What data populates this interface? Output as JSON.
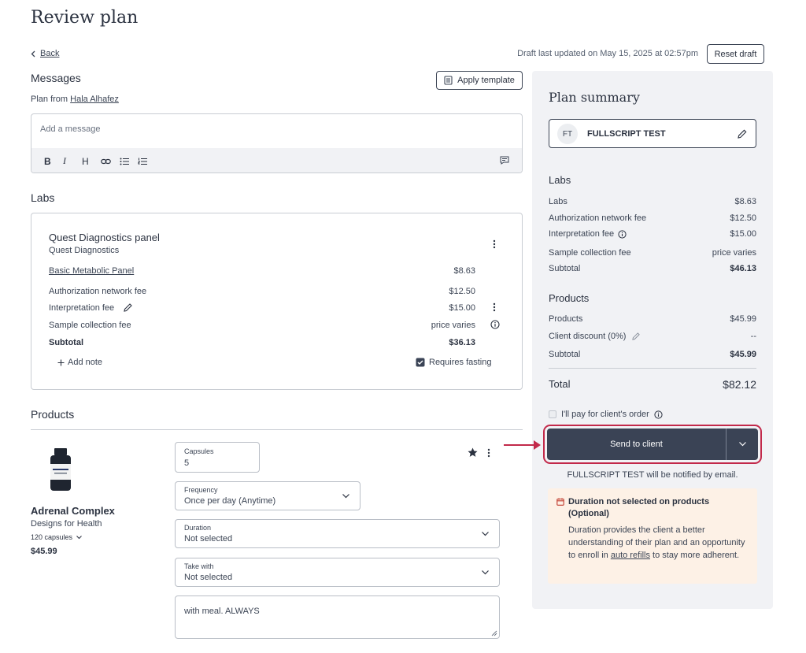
{
  "page": {
    "title": "Review plan"
  },
  "nav": {
    "back_label": "Back"
  },
  "draft": {
    "updated_text": "Draft last updated on May 15, 2025 at 02:57pm",
    "reset_label": "Reset draft"
  },
  "messages": {
    "heading": "Messages",
    "apply_template_label": "Apply template",
    "plan_from_prefix": "Plan from",
    "plan_from_name": "Hala Alhafez",
    "placeholder": "Add a message",
    "toolbar": [
      "bold",
      "italic",
      "heading",
      "link",
      "bullet-list",
      "numbered-list"
    ]
  },
  "labs": {
    "heading": "Labs",
    "panel": {
      "title": "Quest Diagnostics panel",
      "subtitle": "Quest Diagnostics",
      "test_name": "Basic Metabolic Panel",
      "test_price": "$8.63",
      "rows": [
        {
          "label": "Authorization network fee",
          "value": "$12.50"
        },
        {
          "label": "Interpretation fee",
          "value": "$15.00"
        },
        {
          "label": "Sample collection fee",
          "value": "price varies"
        }
      ],
      "subtotal_label": "Subtotal",
      "subtotal_value": "$36.13",
      "add_note_label": "Add note",
      "requires_fasting_label": "Requires fasting"
    }
  },
  "products": {
    "heading": "Products",
    "item": {
      "name": "Adrenal Complex",
      "brand": "Designs for Health",
      "size": "120 capsules",
      "price": "$45.99",
      "capsules_label": "Capsules",
      "capsules_value": "5",
      "frequency_label": "Frequency",
      "frequency_value": "Once per day (Anytime)",
      "duration_label": "Duration",
      "duration_value": "Not selected",
      "takewith_label": "Take with",
      "takewith_value": "Not selected",
      "note_value": "with meal. ALWAYS"
    }
  },
  "summary": {
    "heading": "Plan summary",
    "client_initials": "FT",
    "client_name": "FULLSCRIPT TEST",
    "labs_heading": "Labs",
    "labs_rows": [
      {
        "label": "Labs",
        "value": "$8.63"
      },
      {
        "label": "Authorization network fee",
        "value": "$12.50"
      },
      {
        "label": "Interpretation fee",
        "value": "$15.00"
      },
      {
        "label": "Sample collection fee",
        "value": "price varies"
      }
    ],
    "labs_subtotal_label": "Subtotal",
    "labs_subtotal_value": "$46.13",
    "products_heading": "Products",
    "products_rows": [
      {
        "label": "Products",
        "value": "$45.99"
      },
      {
        "label": "Client discount (0%)",
        "value": "--"
      }
    ],
    "products_subtotal_label": "Subtotal",
    "products_subtotal_value": "$45.99",
    "total_label": "Total",
    "total_value": "$82.12",
    "pay_label": "I'll pay for client's order",
    "send_label": "Send to client",
    "notified_text": "FULLSCRIPT TEST will be notified by email.",
    "warning": {
      "title": "Duration not selected on products (Optional)",
      "body_pre": "Duration provides the client a better understanding of their plan and an opportunity to enroll in",
      "body_link": "auto refills",
      "body_post": "to stay more adherent."
    }
  },
  "colors": {
    "accent": "#3a4355",
    "highlight": "#c2294a",
    "panel_bg": "#f1f2f5",
    "warning_bg": "#fdf1e6",
    "warning_icon": "#c0392b"
  }
}
